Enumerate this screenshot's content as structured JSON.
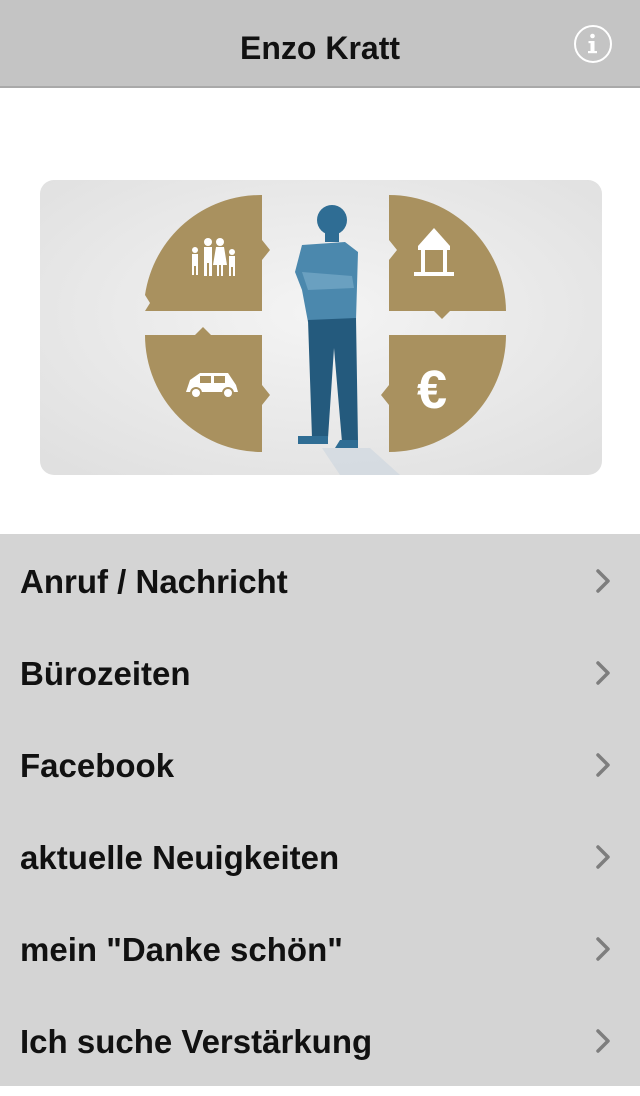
{
  "navbar": {
    "title": "Enzo Kratt",
    "info_icon": "info-icon"
  },
  "banner": {
    "icons": [
      "family-icon",
      "house-icon",
      "car-icon",
      "euro-icon",
      "person-figure"
    ],
    "colors": {
      "quadrant": "#a9915f",
      "figure": "#2f6d94",
      "background": "#ececec"
    }
  },
  "menu": {
    "items": [
      {
        "label": "Anruf / Nachricht"
      },
      {
        "label": "Bürozeiten"
      },
      {
        "label": "Facebook"
      },
      {
        "label": "aktuelle Neuigkeiten"
      },
      {
        "label": "mein \"Danke schön\""
      },
      {
        "label": "Ich suche Verstärkung"
      }
    ],
    "chevron_icon": "chevron-right-icon"
  }
}
